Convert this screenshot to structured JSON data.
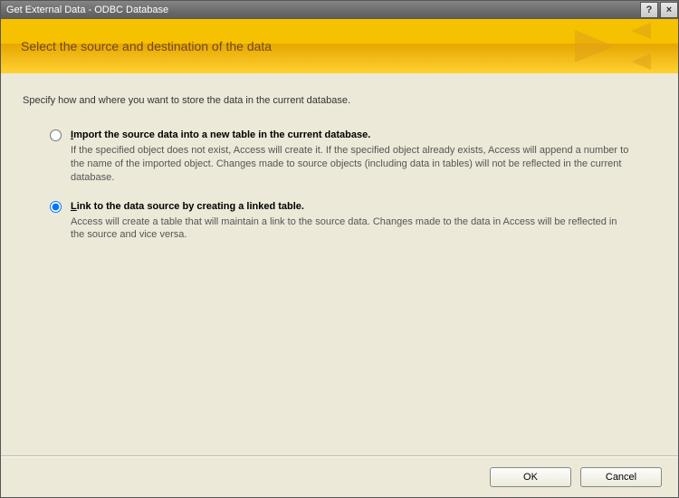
{
  "window": {
    "title": "Get External Data - ODBC Database"
  },
  "header": {
    "heading": "Select the source and destination of the data"
  },
  "content": {
    "intro": "Specify how and where you want to store the data in the current database.",
    "options": [
      {
        "mnemonic": "I",
        "title_rest": "mport the source data into a new table in the current database.",
        "desc": "If the specified object does not exist, Access will create it. If the specified object already exists, Access will append a number to the name of the imported object. Changes made to source objects (including data in tables) will not be reflected in the current database.",
        "selected": false
      },
      {
        "mnemonic": "L",
        "title_rest": "ink to the data source by creating a linked table.",
        "desc": "Access will create a table that will maintain a link to the source data. Changes made to the data in Access will be reflected in the source and vice versa.",
        "selected": true
      }
    ]
  },
  "footer": {
    "ok": "OK",
    "cancel": "Cancel"
  },
  "titlebar": {
    "help": "?",
    "close": "×"
  }
}
